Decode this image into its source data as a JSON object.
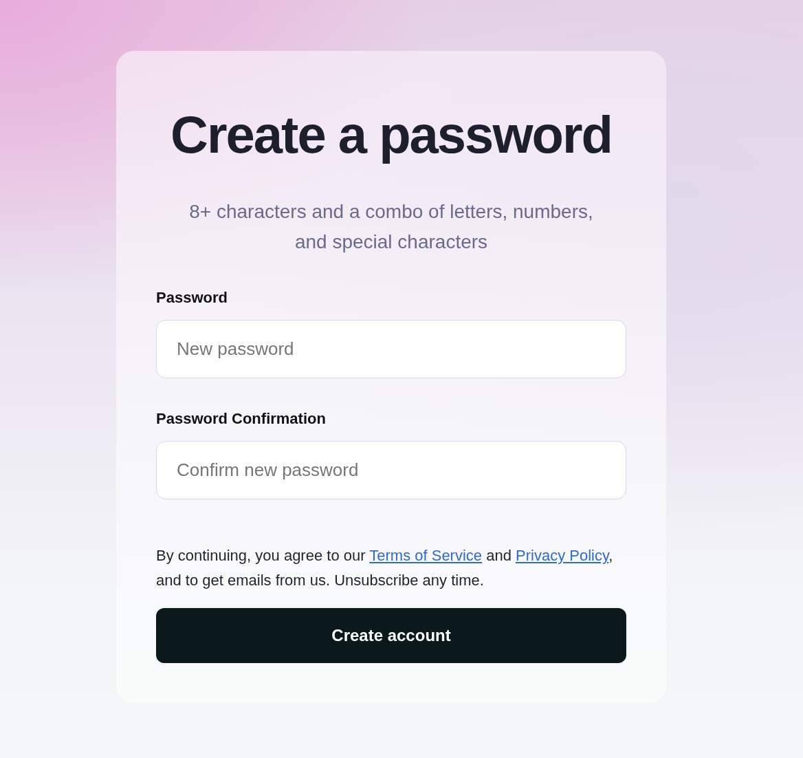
{
  "card": {
    "title": "Create a password",
    "subtitle": "8+ characters and a combo of letters, numbers, and special characters"
  },
  "fields": [
    {
      "label": "Password",
      "placeholder": "New password"
    },
    {
      "label": "Password Confirmation",
      "placeholder": "Confirm new password"
    }
  ],
  "consent": {
    "parts": [
      {
        "kind": "text",
        "text": "By continuing, you agree to our "
      },
      {
        "kind": "link",
        "text": "Terms of Service"
      },
      {
        "kind": "text",
        "text": " and "
      },
      {
        "kind": "link",
        "text": "Privacy Policy"
      },
      {
        "kind": "text",
        "text": ", and to get emails from us. Unsubscribe any time."
      }
    ]
  },
  "button": {
    "label": "Create account"
  }
}
